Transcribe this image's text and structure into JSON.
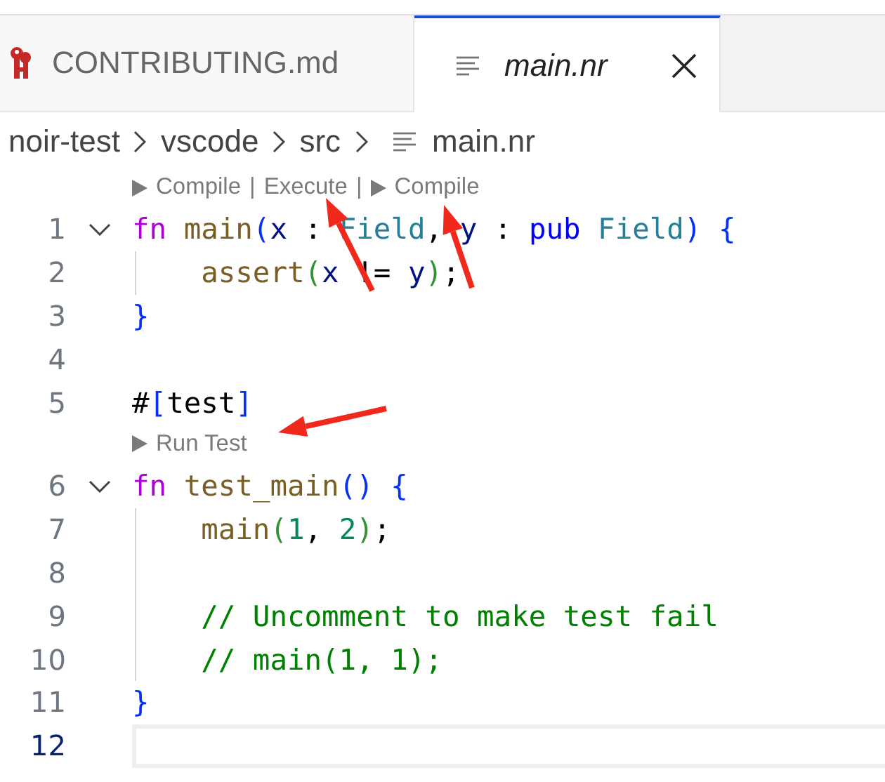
{
  "tabs": [
    {
      "label": "CONTRIBUTING.md",
      "selected": false,
      "preview": false,
      "closable": false
    },
    {
      "label": "main.nr",
      "selected": true,
      "preview": true,
      "closable": true
    }
  ],
  "breadcrumb": [
    {
      "label": "noir-test"
    },
    {
      "label": "vscode"
    },
    {
      "label": "src"
    },
    {
      "label": "main.nr"
    }
  ],
  "lines": [
    {
      "kind": "lens",
      "items": [
        {
          "kind": "run",
          "text": "Compile"
        },
        {
          "kind": "separator",
          "text": "|"
        },
        {
          "kind": "command",
          "text": "Execute"
        },
        {
          "kind": "separator",
          "text": "|"
        },
        {
          "kind": "run",
          "text": "Compile"
        }
      ]
    },
    {
      "kind": "code",
      "number": "1",
      "foldable": true,
      "guide": false,
      "current": false,
      "tokens": [
        {
          "kind": "keyword",
          "text": "fn"
        },
        {
          "kind": "function",
          "text": " main"
        },
        {
          "kind": "bracket1",
          "text": "("
        },
        {
          "kind": "variable",
          "text": "x"
        },
        {
          "kind": "plain",
          "text": " : "
        },
        {
          "kind": "type",
          "text": "Field"
        },
        {
          "kind": "plain",
          "text": ", "
        },
        {
          "kind": "variable",
          "text": "y"
        },
        {
          "kind": "plain",
          "text": " : "
        },
        {
          "kind": "modifier",
          "text": "pub"
        },
        {
          "kind": "type",
          "text": " Field"
        },
        {
          "kind": "bracket1",
          "text": ")"
        },
        {
          "kind": "bracket1",
          "text": " {"
        }
      ]
    },
    {
      "kind": "code",
      "number": "2",
      "foldable": false,
      "guide": true,
      "current": false,
      "tokens": [
        {
          "kind": "function",
          "text": "assert"
        },
        {
          "kind": "bracket2",
          "text": "("
        },
        {
          "kind": "variable",
          "text": "x"
        },
        {
          "kind": "plain",
          "text": " != "
        },
        {
          "kind": "variable",
          "text": "y"
        },
        {
          "kind": "bracket2",
          "text": ")"
        },
        {
          "kind": "plain",
          "text": ";"
        }
      ]
    },
    {
      "kind": "code",
      "number": "3",
      "foldable": false,
      "guide": false,
      "current": false,
      "tokens": [
        {
          "kind": "bracket1",
          "text": "}"
        }
      ]
    },
    {
      "kind": "code",
      "number": "4",
      "foldable": false,
      "guide": false,
      "current": false
    },
    {
      "kind": "code",
      "number": "5",
      "foldable": false,
      "guide": false,
      "current": false,
      "tokens": [
        {
          "kind": "plain",
          "text": "#"
        },
        {
          "kind": "bracket1",
          "text": "["
        },
        {
          "kind": "plain",
          "text": "test"
        },
        {
          "kind": "bracket1",
          "text": "]"
        }
      ]
    },
    {
      "kind": "lens",
      "items": [
        {
          "kind": "run",
          "text": "Run Test"
        }
      ]
    },
    {
      "kind": "code",
      "number": "6",
      "foldable": true,
      "guide": false,
      "current": false,
      "tokens": [
        {
          "kind": "keyword",
          "text": "fn"
        },
        {
          "kind": "function",
          "text": " test_main"
        },
        {
          "kind": "bracket1",
          "text": "()"
        },
        {
          "kind": "bracket1",
          "text": " {"
        }
      ]
    },
    {
      "kind": "code",
      "number": "7",
      "foldable": false,
      "guide": true,
      "current": false,
      "tokens": [
        {
          "kind": "function",
          "text": "main"
        },
        {
          "kind": "bracket2",
          "text": "("
        },
        {
          "kind": "number",
          "text": "1"
        },
        {
          "kind": "plain",
          "text": ", "
        },
        {
          "kind": "number",
          "text": "2"
        },
        {
          "kind": "bracket2",
          "text": ")"
        },
        {
          "kind": "plain",
          "text": ";"
        }
      ]
    },
    {
      "kind": "code",
      "number": "8",
      "foldable": false,
      "guide": true,
      "current": false
    },
    {
      "kind": "code",
      "number": "9",
      "foldable": false,
      "guide": true,
      "current": false,
      "tokens": [
        {
          "kind": "comment",
          "text": "// Uncomment to make test fail"
        }
      ]
    },
    {
      "kind": "code",
      "number": "10",
      "foldable": false,
      "guide": true,
      "current": false,
      "tokens": [
        {
          "kind": "comment",
          "text": "// main(1, 1);"
        }
      ]
    },
    {
      "kind": "code",
      "number": "11",
      "foldable": false,
      "guide": false,
      "current": false,
      "tokens": [
        {
          "kind": "bracket1",
          "text": "}"
        }
      ]
    },
    {
      "kind": "code",
      "number": "12",
      "foldable": false,
      "guide": false,
      "current": true
    }
  ]
}
